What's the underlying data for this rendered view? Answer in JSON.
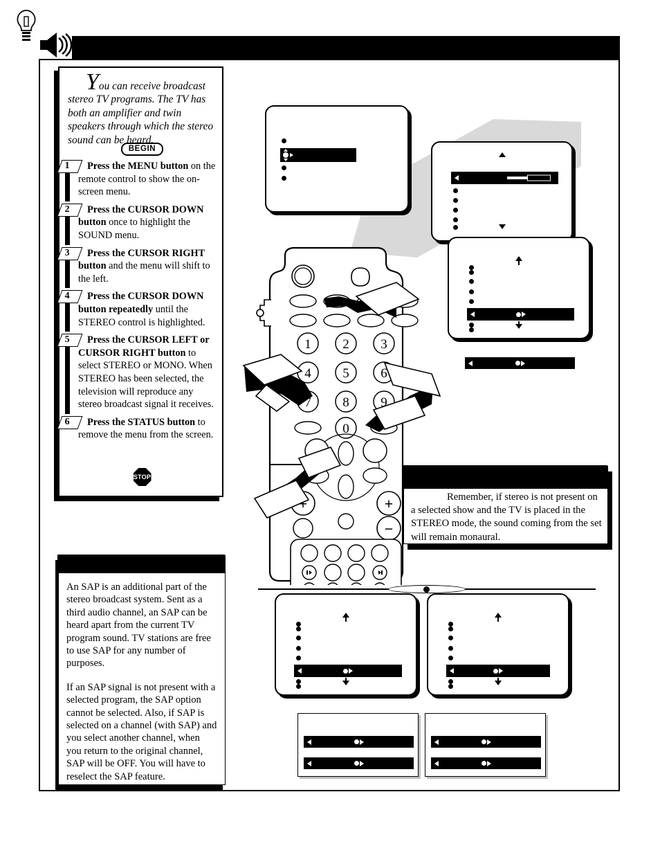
{
  "page": {
    "header_title": "",
    "speaker_icon": "speaker-sound-icon"
  },
  "intro": {
    "text": "You can receive broadcast stereo TV programs.  The TV has both an amplifier and twin speakers through which the stereo sound can be heard."
  },
  "badges": {
    "begin": "BEGIN",
    "stop": "STOP"
  },
  "steps": [
    {
      "number": "1",
      "bold_lead": "Press the MENU button",
      "rest": " on the remote control to show the on-screen menu."
    },
    {
      "number": "2",
      "bold_lead": "Press the CURSOR DOWN button",
      "rest": " once to highlight the SOUND menu."
    },
    {
      "number": "3",
      "bold_lead": "Press the CURSOR RIGHT button",
      "rest": " and the menu will shift to the left."
    },
    {
      "number": "4",
      "bold_lead": "Press the CURSOR DOWN button repeatedly",
      "rest": " until the STEREO control is highlighted."
    },
    {
      "number": "5",
      "bold_lead": "Press the CURSOR LEFT or CURSOR RIGHT button",
      "rest": " to select STEREO or MONO.  When STEREO has been selected, the television will reproduce any stereo broadcast signal it receives."
    },
    {
      "number": "6",
      "bold_lead": "Press the STATUS button",
      "rest": " to remove the menu from the screen."
    }
  ],
  "sap_note": {
    "header_title": "",
    "paragraph1": "An SAP is an additional part of the stereo broadcast system.  Sent as a third audio channel, an SAP can be heard apart from the current TV program sound.  TV stations are free to use SAP for any number of purposes.",
    "paragraph2": "If an SAP signal is not present with a selected program, the SAP option cannot be selected.  Also, if SAP is selected on a channel (with SAP) and you select another channel, when you return to the original channel, SAP will be OFF.  You will have to reselect the SAP feature."
  },
  "tip": {
    "header_title": "",
    "icon": "light-bulb-icon",
    "text": "Remember, if stereo is not present on a selected show and the TV is placed in the STEREO mode, the sound coming from the set will remain monaural."
  },
  "tv_screens": [
    {
      "id": "menu-screen-1",
      "label": "main menu with second item highlighted",
      "bullets": 4,
      "highlight_row_index": 1,
      "highlight_style": "cursor-glyph",
      "arrows": "none"
    },
    {
      "id": "menu-screen-2",
      "label": "shifted menu with slider control highlighted",
      "bullets": 5,
      "highlight_row_index": 0,
      "highlight_style": "slider",
      "arrows": "up-down"
    },
    {
      "id": "menu-screen-3",
      "label": "sound menu with stereo control highlighted",
      "bullets": 5,
      "highlight_row_index": 4,
      "highlight_style": "left-dot-right",
      "arrows": "up-down"
    },
    {
      "id": "menu-screen-4",
      "label": "stereo control highlighted (bottom left)",
      "bullets": 5,
      "highlight_row_index": 4,
      "highlight_style": "left-dot-right",
      "arrows": "up-down"
    },
    {
      "id": "menu-screen-5",
      "label": "stereo control highlighted (bottom right)",
      "bullets": 5,
      "highlight_row_index": 4,
      "highlight_style": "left-dot-right",
      "arrows": "up-down"
    }
  ],
  "standalone_bars": [
    {
      "id": "callout-bar-stereo",
      "style": "left-dot-right"
    }
  ],
  "detail_boxes": [
    {
      "id": "detail-box-left",
      "bars": 2,
      "style": "left-dot-right"
    },
    {
      "id": "detail-box-right",
      "bars": 2,
      "style": "left-dot-right"
    }
  ],
  "remote": {
    "keypad": [
      "1",
      "2",
      "3",
      "4",
      "5",
      "6",
      "7",
      "8",
      "9",
      "0"
    ],
    "volume_plus": "+",
    "channel_plus": "+",
    "minus": "−",
    "transport": [
      "skip-back-icon",
      "skip-forward-icon",
      "rewind-icon",
      "stop-icon",
      "play-icon",
      "fast-forward-icon",
      "pause-icon",
      "eject-icon"
    ]
  },
  "colors": {
    "ink": "#000000",
    "paper": "#ffffff",
    "beam_gray": "#d9d9d9"
  }
}
